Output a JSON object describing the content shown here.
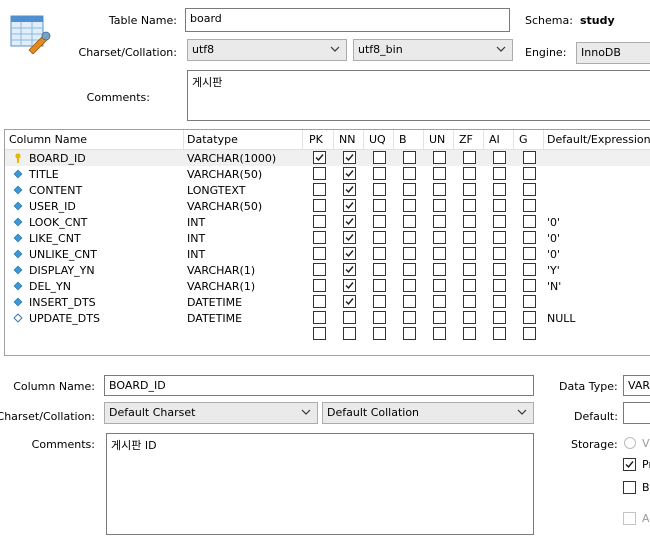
{
  "table": {
    "name_label": "Table Name:",
    "name_value": "board",
    "schema_label": "Schema:",
    "schema_value": "study",
    "charset_label": "Charset/Collation:",
    "charset_value": "utf8",
    "collation_value": "utf8_bin",
    "engine_label": "Engine:",
    "engine_value": "InnoDB",
    "comments_label": "Comments:",
    "comments_value": "게시판"
  },
  "grid": {
    "headers": [
      "Column Name",
      "Datatype",
      "PK",
      "NN",
      "UQ",
      "B",
      "UN",
      "ZF",
      "AI",
      "G",
      "Default/Expression"
    ],
    "rows": [
      {
        "icon": "key",
        "name": "BOARD_ID",
        "type": "VARCHAR(1000)",
        "flags": [
          1,
          1,
          0,
          0,
          0,
          0,
          0,
          0
        ],
        "default": "",
        "selected": true
      },
      {
        "icon": "diamond",
        "name": "TITLE",
        "type": "VARCHAR(50)",
        "flags": [
          0,
          1,
          0,
          0,
          0,
          0,
          0,
          0
        ],
        "default": ""
      },
      {
        "icon": "diamond",
        "name": "CONTENT",
        "type": "LONGTEXT",
        "flags": [
          0,
          1,
          0,
          0,
          0,
          0,
          0,
          0
        ],
        "default": ""
      },
      {
        "icon": "diamond",
        "name": "USER_ID",
        "type": "VARCHAR(50)",
        "flags": [
          0,
          1,
          0,
          0,
          0,
          0,
          0,
          0
        ],
        "default": ""
      },
      {
        "icon": "diamond",
        "name": "LOOK_CNT",
        "type": "INT",
        "flags": [
          0,
          1,
          0,
          0,
          0,
          0,
          0,
          0
        ],
        "default": "'0'"
      },
      {
        "icon": "diamond",
        "name": "LIKE_CNT",
        "type": "INT",
        "flags": [
          0,
          1,
          0,
          0,
          0,
          0,
          0,
          0
        ],
        "default": "'0'"
      },
      {
        "icon": "diamond",
        "name": "UNLIKE_CNT",
        "type": "INT",
        "flags": [
          0,
          1,
          0,
          0,
          0,
          0,
          0,
          0
        ],
        "default": "'0'"
      },
      {
        "icon": "diamond",
        "name": "DISPLAY_YN",
        "type": "VARCHAR(1)",
        "flags": [
          0,
          1,
          0,
          0,
          0,
          0,
          0,
          0
        ],
        "default": "'Y'"
      },
      {
        "icon": "diamond",
        "name": "DEL_YN",
        "type": "VARCHAR(1)",
        "flags": [
          0,
          1,
          0,
          0,
          0,
          0,
          0,
          0
        ],
        "default": "'N'"
      },
      {
        "icon": "diamond",
        "name": "INSERT_DTS",
        "type": "DATETIME",
        "flags": [
          0,
          1,
          0,
          0,
          0,
          0,
          0,
          0
        ],
        "default": ""
      },
      {
        "icon": "diamond-hollow",
        "name": "UPDATE_DTS",
        "type": "DATETIME",
        "flags": [
          0,
          0,
          0,
          0,
          0,
          0,
          0,
          0
        ],
        "default": "NULL"
      },
      {
        "icon": "",
        "name": "",
        "type": "",
        "flags": [
          0,
          0,
          0,
          0,
          0,
          0,
          0,
          0
        ],
        "default": ""
      }
    ]
  },
  "detail": {
    "column_name_label": "Column Name:",
    "column_name_value": "BOARD_ID",
    "data_type_label": "Data Type:",
    "data_type_value": "VARC",
    "charset_label": "Charset/Collation:",
    "charset_value": "Default Charset",
    "collation_value": "Default Collation",
    "default_label": "Default:",
    "default_value": "",
    "comments_label": "Comments:",
    "comments_value": "게시판 ID",
    "storage_label": "Storage:",
    "storage_virtual": "Vi",
    "storage_primary": "Pr",
    "binary_label": "Bi",
    "auto_label": "A"
  },
  "colors": {
    "accent": "#3a9ad9",
    "key": "#e6b800",
    "check": "#1a1a1a"
  }
}
